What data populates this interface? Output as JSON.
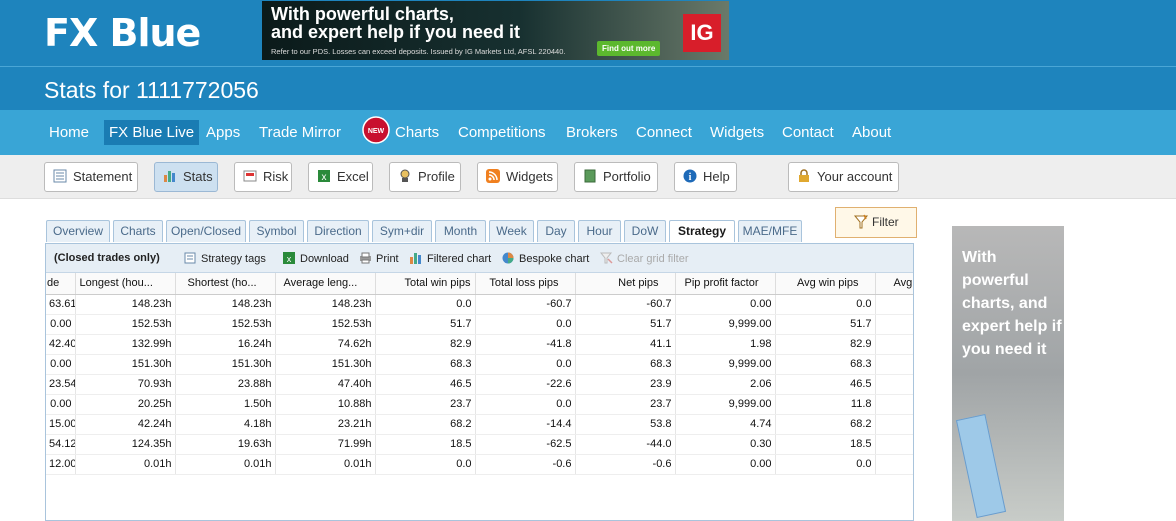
{
  "header": {
    "logo": "FX Blue",
    "title": "Stats for 1111772056"
  },
  "ad_top": {
    "line1": "With powerful charts,",
    "line2": "and expert help if you need it",
    "fine_print": "Refer to our PDS. Losses can exceed deposits. Issued by IG Markets Ltd, AFSL 220440.",
    "cta": "Find out more",
    "brand": "IG"
  },
  "nav": {
    "items": [
      "Home",
      "FX Blue Live",
      "Apps",
      "Trade Mirror",
      "Charts",
      "Competitions",
      "Brokers",
      "Connect",
      "Widgets",
      "Contact",
      "About"
    ],
    "active": "FX Blue Live",
    "new_badge": "NEW"
  },
  "toolbar": {
    "buttons": [
      "Statement",
      "Stats",
      "Risk",
      "Excel",
      "Profile",
      "Widgets",
      "Portfolio",
      "Help"
    ],
    "account": "Your account"
  },
  "tabs": [
    "Overview",
    "Charts",
    "Open/Closed",
    "Symbol",
    "Direction",
    "Sym+dir",
    "Month",
    "Week",
    "Day",
    "Hour",
    "DoW",
    "Strategy",
    "MAE/MFE"
  ],
  "active_tab": "Strategy",
  "filter_label": "Filter",
  "panel_toolbar": {
    "closed_only": "(Closed trades only)",
    "strategy_tags": "Strategy tags",
    "download": "Download",
    "print": "Print",
    "filtered_chart": "Filtered chart",
    "bespoke_chart": "Bespoke chart",
    "clear_grid_filter": "Clear grid filter"
  },
  "table": {
    "headers": [
      "de",
      "Longest (hou...",
      "Shortest (ho...",
      "Average leng...",
      "Total win pips",
      "Total loss pips",
      "Net pips",
      "Pip profit factor",
      "Avg win pips",
      "Avg"
    ],
    "rows": [
      [
        "63.61",
        "148.23h",
        "148.23h",
        "148.23h",
        "0.0",
        "-60.7",
        "-60.7",
        "0.00",
        "0.0"
      ],
      [
        "0.00",
        "152.53h",
        "152.53h",
        "152.53h",
        "51.7",
        "0.0",
        "51.7",
        "9,999.00",
        "51.7"
      ],
      [
        "42.40",
        "132.99h",
        "16.24h",
        "74.62h",
        "82.9",
        "-41.8",
        "41.1",
        "1.98",
        "82.9"
      ],
      [
        "0.00",
        "151.30h",
        "151.30h",
        "151.30h",
        "68.3",
        "0.0",
        "68.3",
        "9,999.00",
        "68.3"
      ],
      [
        "23.54",
        "70.93h",
        "23.88h",
        "47.40h",
        "46.5",
        "-22.6",
        "23.9",
        "2.06",
        "46.5"
      ],
      [
        "0.00",
        "20.25h",
        "1.50h",
        "10.88h",
        "23.7",
        "0.0",
        "23.7",
        "9,999.00",
        "11.8"
      ],
      [
        "15.00",
        "42.24h",
        "4.18h",
        "23.21h",
        "68.2",
        "-14.4",
        "53.8",
        "4.74",
        "68.2"
      ],
      [
        "54.12",
        "124.35h",
        "19.63h",
        "71.99h",
        "18.5",
        "-62.5",
        "-44.0",
        "0.30",
        "18.5"
      ],
      [
        "12.00",
        "0.01h",
        "0.01h",
        "0.01h",
        "0.0",
        "-0.6",
        "-0.6",
        "0.00",
        "0.0"
      ]
    ]
  },
  "ad_side": {
    "text": "With powerful charts, and expert help if you need it"
  }
}
